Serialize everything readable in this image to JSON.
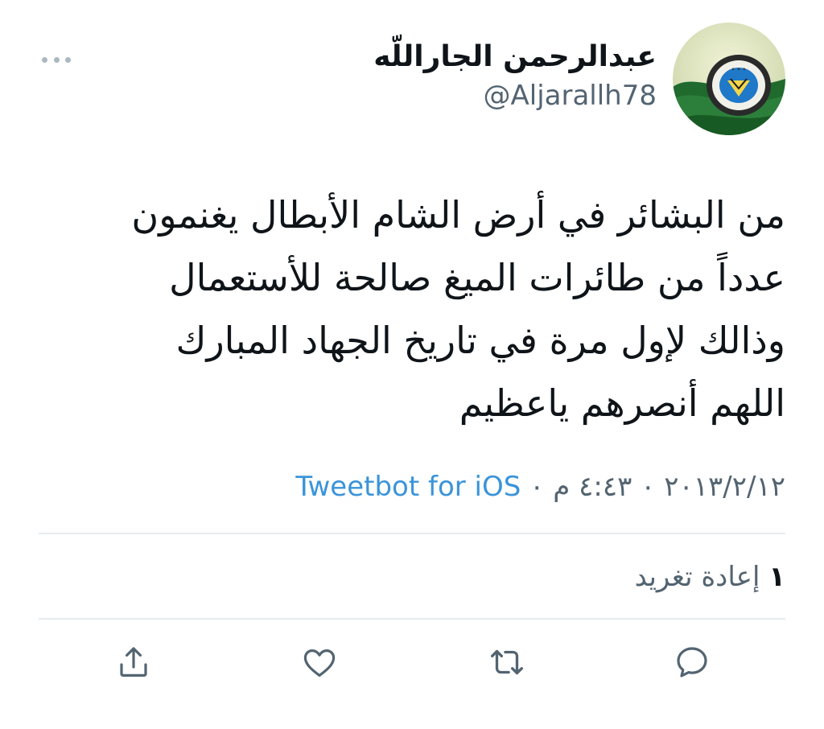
{
  "user": {
    "display_name": "عبدالرحمن الجاراللّه",
    "handle": "@Aljarallh78",
    "avatar_icon": "profile-avatar-emblem"
  },
  "tweet": {
    "text": "من البشائر في أرض الشام الأبطال يغنمون\nعدداً من طائرات الميغ صالحة للأستعمال\nوذالك لإول مرة في تاريخ الجهاد المبارك\nاللهم أنصرهم ياعظيم",
    "date_time": "٢٠١٣/٢/١٢ ٠ ٤:٤٣ م ٠",
    "source": "Tweetbot for iOS"
  },
  "stats": {
    "retweet_count": "١",
    "retweet_label": "إعادة تغريد"
  },
  "actions": [
    {
      "icon": "reply-icon"
    },
    {
      "icon": "retweet-icon"
    },
    {
      "icon": "like-icon"
    },
    {
      "icon": "share-icon"
    }
  ],
  "colors": {
    "text_primary": "#0f1419",
    "text_secondary": "#536471",
    "link": "#3b94d9",
    "divider": "#e6ecf0",
    "icon": "#536471"
  }
}
